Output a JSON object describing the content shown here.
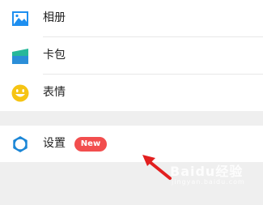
{
  "menu": {
    "items": [
      {
        "label": "相册",
        "icon": "photo-album-icon"
      },
      {
        "label": "卡包",
        "icon": "card-wallet-icon"
      },
      {
        "label": "表情",
        "icon": "smiley-face-icon"
      }
    ],
    "settings": {
      "label": "设置",
      "icon": "gear-icon",
      "badge": "New"
    }
  },
  "colors": {
    "album_blue": "#1e8ff0",
    "wallet_blue": "#2b8ed8",
    "wallet_green": "#27b89a",
    "smiley_yellow": "#f6c413",
    "settings_blue": "#1b86d6",
    "badge_red": "#f24e4e",
    "arrow_red": "#e21f1f",
    "background": "#efefef"
  },
  "watermark": {
    "brand": "Baidu经验",
    "sub": "jingyan.baidu.com"
  }
}
